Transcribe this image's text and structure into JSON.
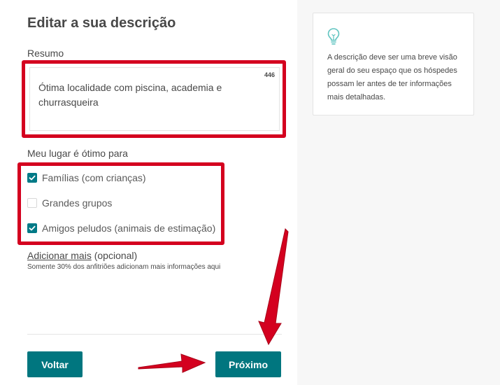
{
  "page": {
    "title": "Editar a sua descrição"
  },
  "summary": {
    "label": "Resumo",
    "char_count": "446",
    "value": "Ótima localidade com piscina, academia e churrasqueira"
  },
  "great_for": {
    "label": "Meu lugar é ótimo para",
    "options": [
      {
        "label": "Famílias (com crianças)",
        "checked": true
      },
      {
        "label": "Grandes grupos",
        "checked": false
      },
      {
        "label": "Amigos peludos (animais de estimação)",
        "checked": true
      }
    ]
  },
  "add_more": {
    "link": "Adicionar mais",
    "suffix": " (opcional)",
    "note": "Somente 30% dos anfitriões adicionam mais informações aqui"
  },
  "buttons": {
    "back": "Voltar",
    "next": "Próximo"
  },
  "tip": {
    "icon": "lightbulb-icon",
    "text": "A descrição deve ser uma breve visão geral do seu espaço que os hóspedes possam ler antes de ter informações mais detalhadas."
  },
  "colors": {
    "accent": "#00767f",
    "checkbox": "#007a87",
    "highlight": "#d4001f",
    "tip_icon": "#5fc4c0"
  }
}
